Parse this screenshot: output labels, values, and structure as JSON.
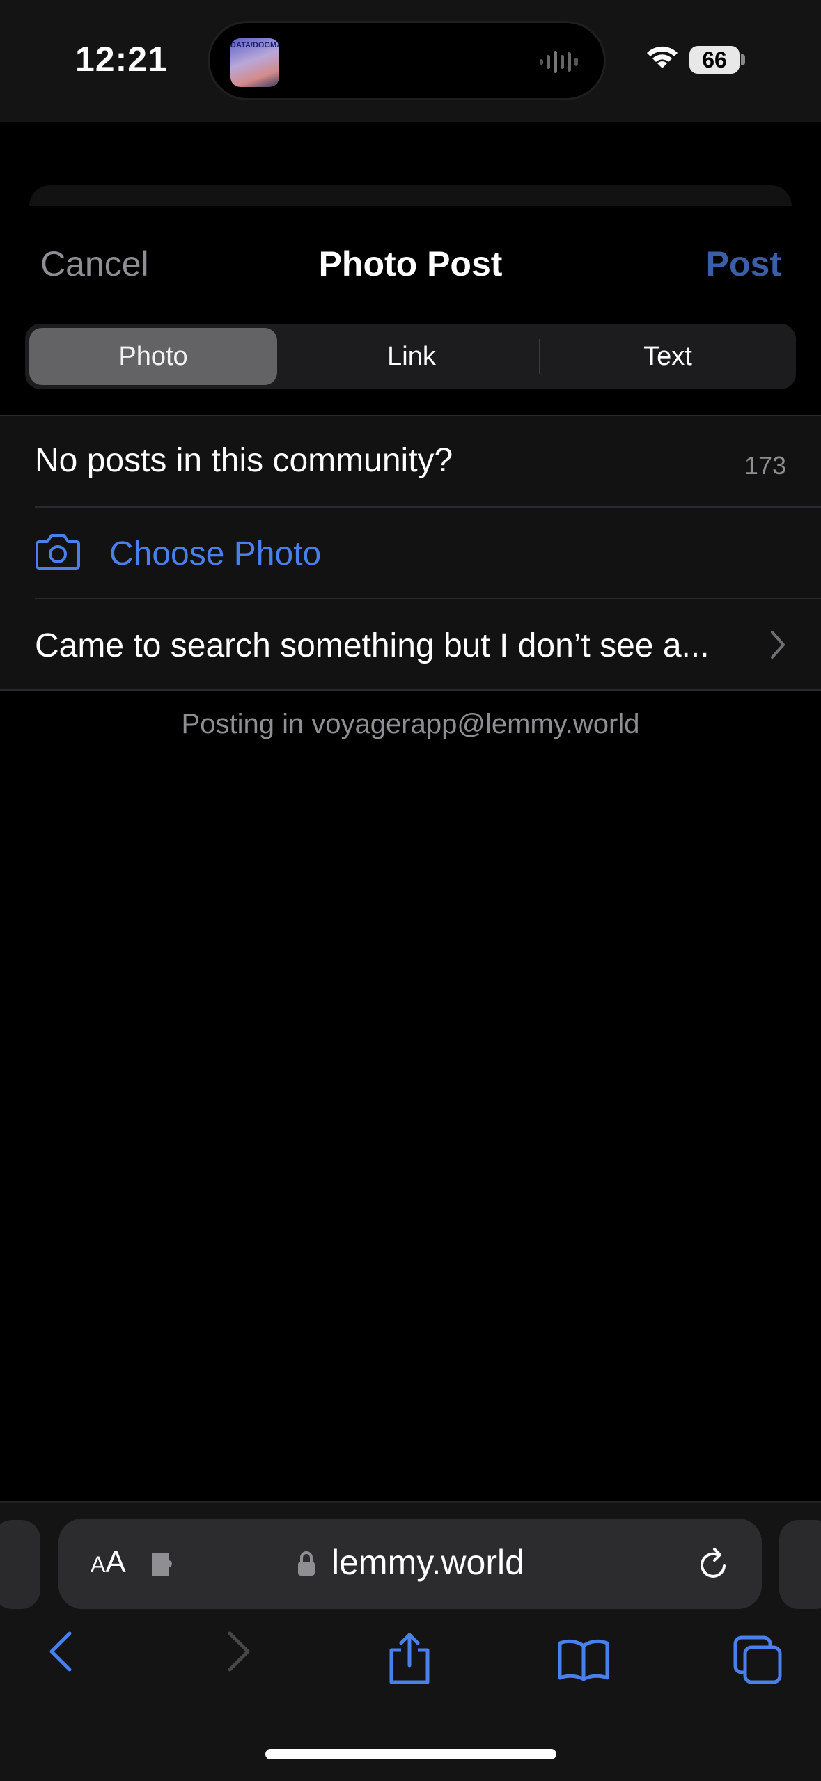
{
  "status_bar": {
    "time": "12:21",
    "island_app_label": "DATA/DOGMA",
    "battery": "66"
  },
  "nav": {
    "cancel": "Cancel",
    "title": "Photo Post",
    "post": "Post"
  },
  "segments": {
    "photo": "Photo",
    "link": "Link",
    "text": "Text",
    "selected": "Photo"
  },
  "form": {
    "title_value": "No posts in this community?",
    "title_count": "173",
    "choose_photo": "Choose Photo",
    "body_preview": "Came to search something but I don’t see a..."
  },
  "posting_in": "Posting in voyagerapp@lemmy.world",
  "safari": {
    "aa_small": "A",
    "aa_large": "A",
    "url": "lemmy.world"
  },
  "colors": {
    "accent": "#4a80ec",
    "post_disabled": "#3a5fa8",
    "secondary_text": "#8e8e93"
  }
}
